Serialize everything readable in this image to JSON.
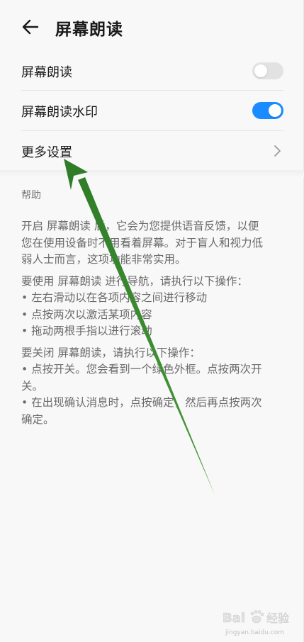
{
  "header": {
    "title": "屏幕朗读",
    "back_icon": "back-arrow-icon"
  },
  "settings": {
    "screen_reader": {
      "label": "屏幕朗读",
      "toggle_state": "off"
    },
    "watermark": {
      "label": "屏幕朗读水印",
      "toggle_state": "on"
    },
    "more_settings": {
      "label": "更多设置",
      "icon": "chevron-right-icon"
    }
  },
  "help": {
    "title": "帮助",
    "para1": [
      "开启 屏幕朗读 后，它会为您提供语音反馈，以便",
      "您在使用设备时不用看着屏幕。对于盲人和视力低",
      "弱人士而言，这项功能非常实用。"
    ],
    "para2": [
      "要使用 屏幕朗读 进行导航，请执行以下操作：",
      "• 左右滑动以在各项内容之间进行移动",
      "• 点按两次以激活某项内容",
      "• 拖动两根手指以进行滚动"
    ],
    "para3": [
      "要关闭 屏幕朗读，请执行以下操作：",
      "• 点按开关。您会看到一个绿色外框。点按两次开",
      "关。",
      "• 在出现确认消息时，点按确定，然后再点按两次",
      "确定。"
    ]
  },
  "colors": {
    "accent": "#1a8cff",
    "annotation_arrow": "#3a8a30"
  },
  "watermark": {
    "logo": "Bai",
    "site": "jingyan.baidu.com"
  }
}
